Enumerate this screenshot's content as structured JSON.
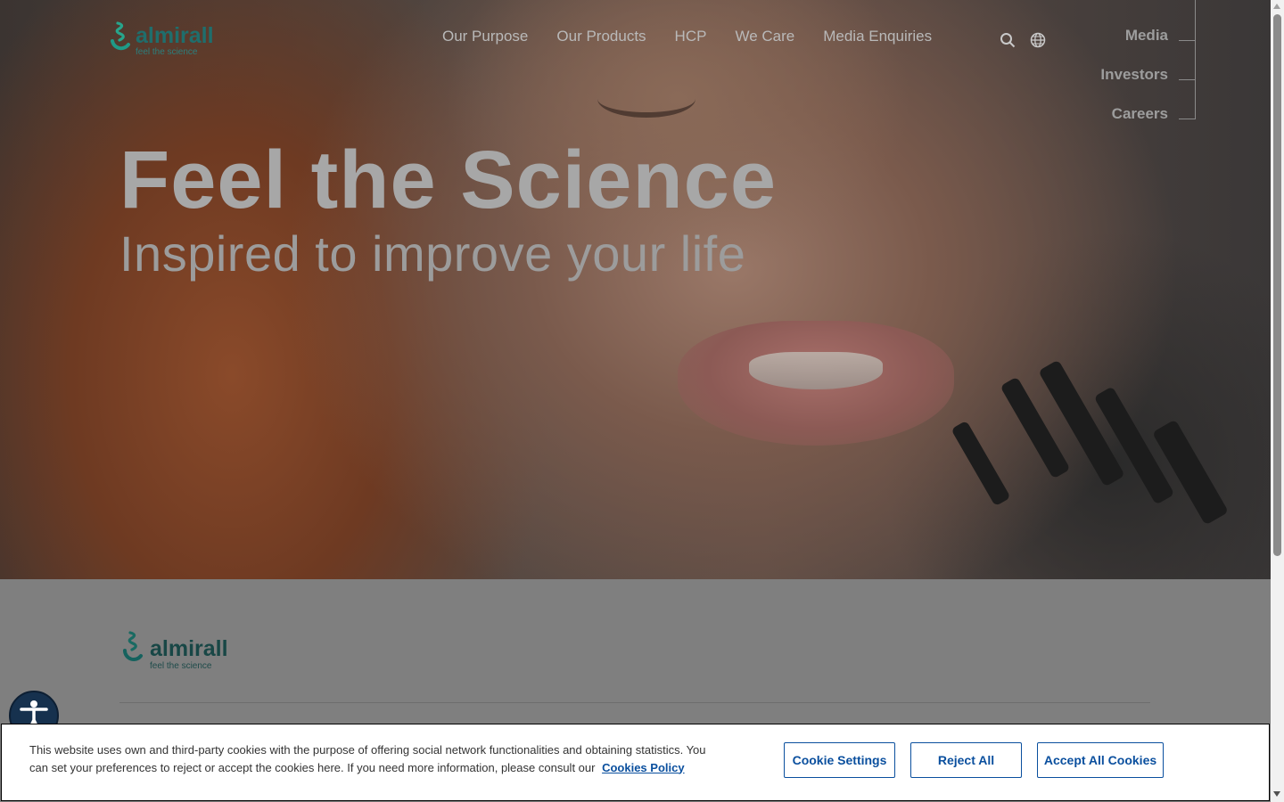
{
  "brand": {
    "name": "almirall",
    "tagline": "feel the science"
  },
  "nav": {
    "items": [
      "Our Purpose",
      "Our Products",
      "HCP",
      "We Care",
      "Media Enquiries"
    ]
  },
  "header_icons": [
    "search-icon",
    "globe-icon"
  ],
  "side_links": [
    "Media",
    "Investors",
    "Careers"
  ],
  "hero": {
    "headline": "Feel the Science",
    "subheadline": "Inspired to improve your life"
  },
  "footer_logo": {
    "name": "almirall",
    "tagline": "feel the science"
  },
  "accessibility_button": {
    "icon": "accessibility-icon"
  },
  "cookie_banner": {
    "text": "This website uses own and third-party cookies with the purpose of offering social network functionalities and obtaining statistics. You can set your preferences to reject or accept the cookies here. If you need more information, please consult our",
    "policy_link": "Cookies Policy",
    "settings_button": "Cookie Settings",
    "reject_button": "Reject All",
    "accept_button": "Accept All Cookies"
  },
  "colors": {
    "brand_teal": "#1f6e6c",
    "link_blue": "#0a4f9e",
    "a11y_navy": "#16314e"
  }
}
